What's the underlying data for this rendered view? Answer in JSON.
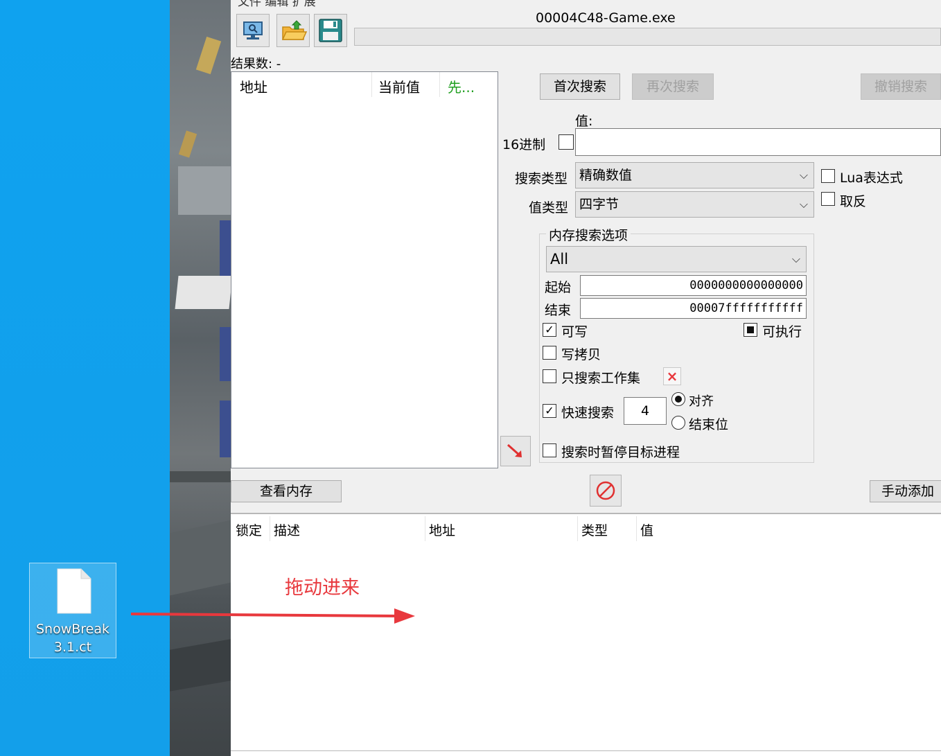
{
  "desktop": {
    "file_icon": {
      "name_line1": "SnowBreak",
      "name_line2": "3.1.ct",
      "icon": "document-icon"
    }
  },
  "window": {
    "menu_partial": "文件  编辑  扩展",
    "title": "00004C48-Game.exe",
    "toolbar": {
      "open_process_icon": "computer-icon",
      "open_file_icon": "folder-open-icon",
      "save_icon": "floppy-icon"
    },
    "result_count": "结果数: -",
    "results_columns": [
      "地址",
      "当前值",
      "先..."
    ],
    "first_scan": "首次搜索",
    "next_scan": "再次搜索",
    "undo_scan": "撤销搜索",
    "value_label": "值:",
    "hex_label": "16进制",
    "scan_type_label": "搜索类型",
    "scan_type_value": "精确数值",
    "value_type_label": "值类型",
    "value_type_value": "四字节",
    "lua_label": "Lua表达式",
    "not_label": "取反",
    "mem_group_title": "内存搜索选项",
    "mem_region": "All",
    "start_label": "起始",
    "start_value": "0000000000000000",
    "stop_label": "结束",
    "stop_value": "00007fffffffffff",
    "writable_label": "可写",
    "executable_label": "可执行",
    "copy_on_write_label": "写拷贝",
    "working_set_label": "只搜索工作集",
    "fast_scan_label": "快速搜索",
    "fast_scan_value": "4",
    "aligned_label": "对齐",
    "last_digits_label": "结束位",
    "pause_label": "搜索时暂停目标进程",
    "memory_view": "查看内存",
    "add_manually": "手动添加",
    "table_columns": [
      "锁定",
      "描述",
      "地址",
      "类型",
      "值"
    ]
  },
  "annotation": {
    "text": "拖动进来",
    "color": "#e8383d"
  },
  "colors": {
    "desktop": "#139fea",
    "window": "#f0f0f0",
    "accent_red": "#e8383d",
    "green_header": "#1e9e1e"
  }
}
